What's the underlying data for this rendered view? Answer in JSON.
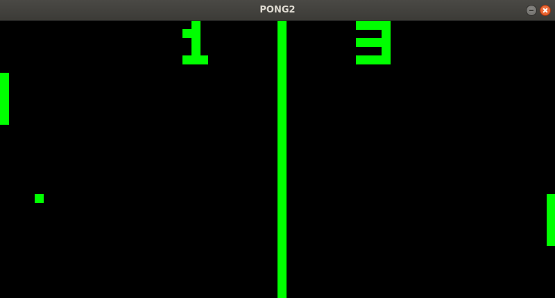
{
  "window": {
    "title": "PONG2"
  },
  "icons": {
    "minimize": "minimize-icon",
    "close": "close-icon"
  },
  "colors": {
    "game": "#00ff00",
    "background": "#000000",
    "titlebar": "#3c3b37",
    "close_button": "#e95420"
  },
  "score": {
    "left": "1",
    "right": "3"
  }
}
